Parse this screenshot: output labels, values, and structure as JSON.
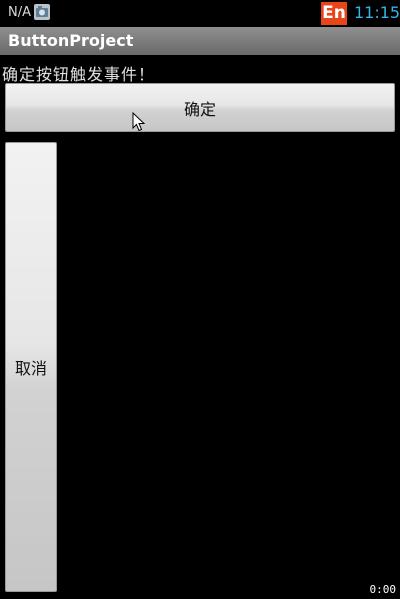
{
  "status_bar": {
    "carrier": "N/A",
    "notification_icon": "camera-notification-icon",
    "ime_label": "En",
    "time": "11:15"
  },
  "title_bar": {
    "title": "ButtonProject"
  },
  "content": {
    "message": "确定按钮触发事件！",
    "confirm_label": "确定",
    "cancel_label": "取消"
  },
  "overlay": {
    "cursor_icon": "mouse-pointer-icon",
    "timer": "0:00"
  },
  "colors": {
    "ime_badge": "#e8461a",
    "clock": "#33b5e5",
    "title_bar": "#7a7a7a",
    "background": "#000000"
  }
}
